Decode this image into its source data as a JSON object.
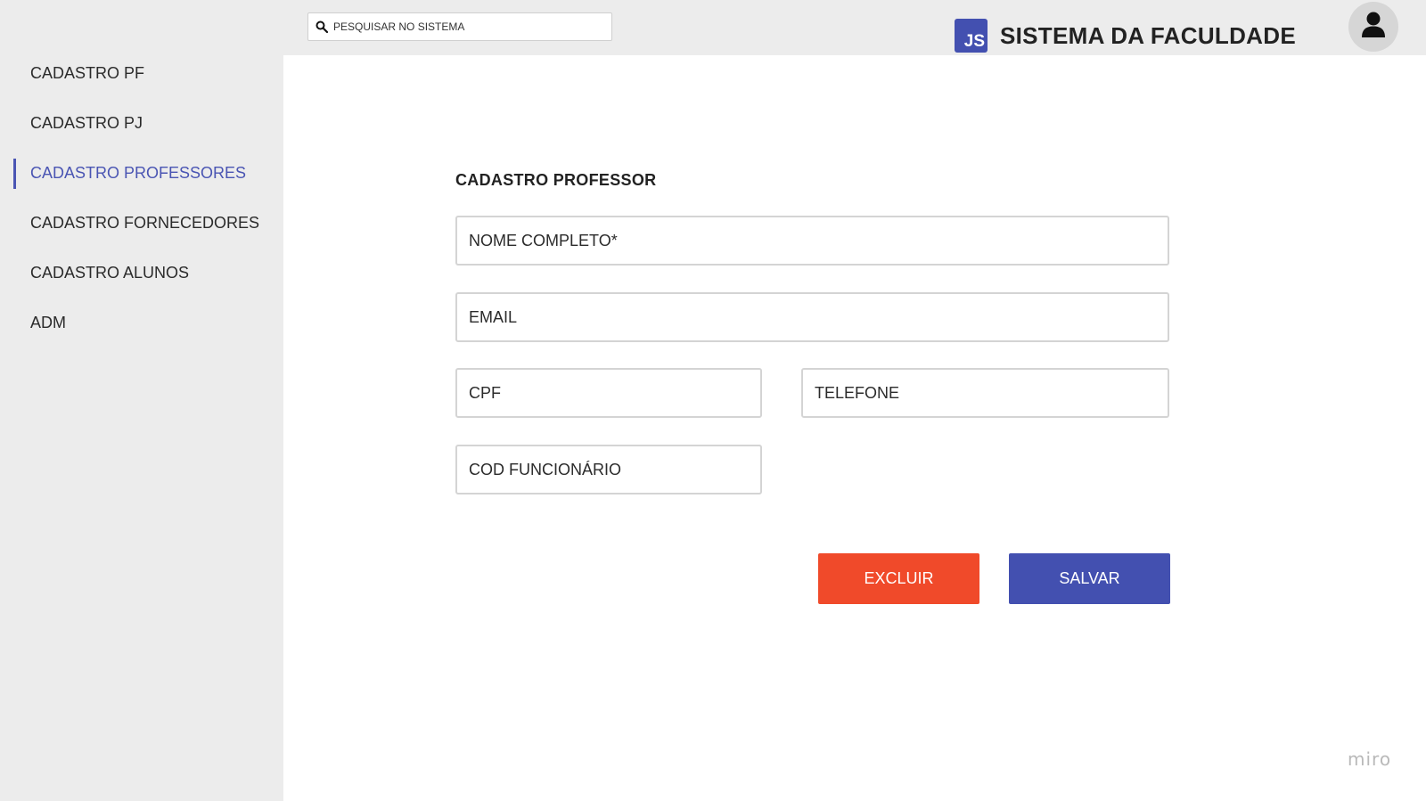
{
  "header": {
    "search": {
      "placeholder": "PESQUISAR NO SISTEMA",
      "icon": "search-icon"
    },
    "brand": {
      "logo_text": "JS",
      "title": "SISTEMA DA FACULDADE",
      "logo_color": "#4350b0"
    },
    "user_icon": "user-icon"
  },
  "sidebar": {
    "items": [
      {
        "label": "CADASTRO PF",
        "active": false
      },
      {
        "label": "CADASTRO PJ",
        "active": false
      },
      {
        "label": "CADASTRO PROFESSORES",
        "active": true
      },
      {
        "label": "CADASTRO FORNECEDORES",
        "active": false
      },
      {
        "label": "CADASTRO ALUNOS",
        "active": false
      },
      {
        "label": "ADM",
        "active": false
      }
    ],
    "active_color": "#4a55b3"
  },
  "form": {
    "title": "CADASTRO PROFESSOR",
    "fields": {
      "nome": {
        "placeholder": "NOME COMPLETO*",
        "value": ""
      },
      "email": {
        "placeholder": "EMAIL",
        "value": ""
      },
      "cpf": {
        "placeholder": "CPF",
        "value": ""
      },
      "telefone": {
        "placeholder": "TELEFONE",
        "value": ""
      },
      "cod": {
        "placeholder": "COD FUNCIONÁRIO",
        "value": ""
      }
    },
    "buttons": {
      "excluir": {
        "label": "EXCLUIR",
        "color": "#f04a2a"
      },
      "salvar": {
        "label": "SALVAR",
        "color": "#4350b0"
      }
    }
  },
  "watermark": "miro"
}
